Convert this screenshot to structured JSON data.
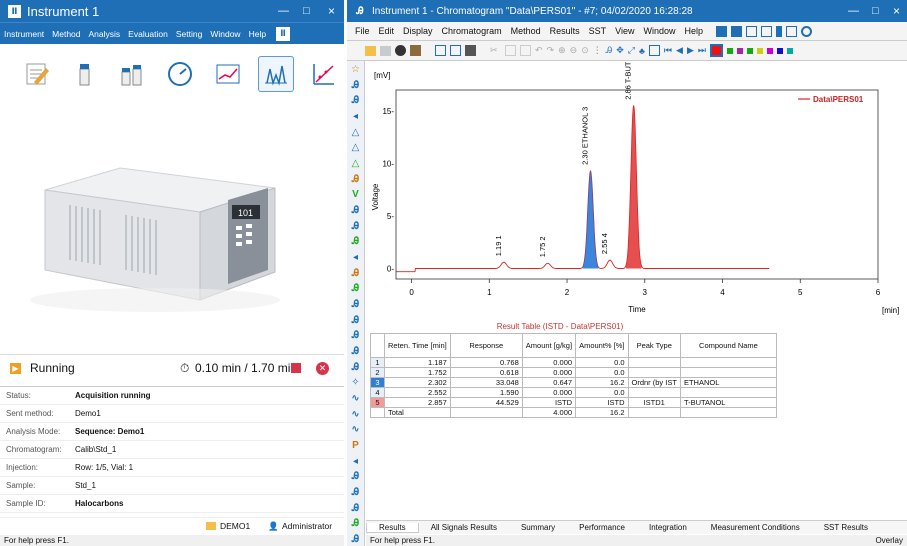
{
  "left_window": {
    "title": "Instrument 1",
    "controls": [
      "—",
      "□",
      "×"
    ],
    "menu": [
      "Instrument",
      "Method",
      "Analysis",
      "Evaluation",
      "Setting",
      "Window",
      "Help"
    ],
    "tools": [
      "edit-method-icon",
      "single-vial-icon",
      "sequence-vials-icon",
      "gauge-monitor-icon",
      "trend-chart-icon",
      "chromatogram-icon",
      "calibration-icon"
    ],
    "instrument_display": "101",
    "status_label": "Running",
    "time_text": "0.10 min / 1.70 min",
    "info": [
      {
        "k": "Status:",
        "v": "Acquisition running",
        "bold": true
      },
      {
        "k": "Sent method:",
        "v": "Demo1"
      },
      {
        "k": "Analysis Mode:",
        "v": "Sequence: Demo1",
        "bold": true
      },
      {
        "k": "Chromatogram:",
        "v": "Calib\\Std_1"
      },
      {
        "k": "Injection:",
        "v": "Row: 1/5, Vial: 1"
      },
      {
        "k": "Sample:",
        "v": "Std_1"
      },
      {
        "k": "Sample ID:",
        "v": "Halocarbons",
        "bold": true
      }
    ],
    "project": "DEMO1",
    "user": "Administrator",
    "statusbar": "For help press F1."
  },
  "right_window": {
    "title": "Instrument 1 - Chromatogram \"Data\\PERS01\" - #7;  04/02/2020  16:28:28",
    "menu": [
      "File",
      "Edit",
      "Display",
      "Chromatogram",
      "Method",
      "Results",
      "SST",
      "View",
      "Window",
      "Help"
    ],
    "statusbar": "For help press F1.",
    "overlay": "Overlay",
    "tabs": [
      "Results",
      "All Signals Results",
      "Summary",
      "Performance",
      "Integration",
      "Measurement Conditions",
      "SST Results"
    ]
  },
  "chart_data": {
    "type": "line",
    "ylabel": "Voltage",
    "yunit": "[mV]",
    "xlabel": "Time",
    "xunit": "[min]",
    "xlim": [
      -0.2,
      6
    ],
    "ylim": [
      -1,
      17
    ],
    "xticks": [
      "0",
      "1",
      "2",
      "3",
      "4",
      "5",
      "6"
    ],
    "yticks": [
      "0-",
      "5-",
      "10-",
      "15-"
    ],
    "legend": "Data\\PERS01",
    "peaks": [
      {
        "rt": 1.187,
        "h": 0.6,
        "label": "1.19  1",
        "color": "#d33"
      },
      {
        "rt": 1.752,
        "h": 0.5,
        "label": "1.75  2",
        "color": "#d33"
      },
      {
        "rt": 2.302,
        "h": 9.3,
        "label": "2.30 ETHANOL  3",
        "color": "#1b6fd6"
      },
      {
        "rt": 2.552,
        "h": 0.8,
        "label": "2.55  4",
        "color": "#d33"
      },
      {
        "rt": 2.857,
        "h": 15.5,
        "label": "2.86 T-BUTANOL  5",
        "color": "#e03030"
      }
    ]
  },
  "result_table": {
    "title": "Result Table (ISTD - Data\\PERS01)",
    "headers": [
      "",
      "Reten. Time [min]",
      "Response",
      "Amount [g/kg]",
      "Amount% [%]",
      "Peak Type",
      "Compound Name"
    ],
    "rows": [
      [
        "1",
        "1.187",
        "0.768",
        "0.000",
        "0.0",
        "",
        ""
      ],
      [
        "2",
        "1.752",
        "0.618",
        "0.000",
        "0.0",
        "",
        ""
      ],
      [
        "3",
        "2.302",
        "33.048",
        "0.647",
        "16.2",
        "Ordnr (by IST",
        "ETHANOL"
      ],
      [
        "4",
        "2.552",
        "1.590",
        "0.000",
        "0.0",
        "",
        ""
      ],
      [
        "5",
        "2.857",
        "44.529",
        "ISTD",
        "ISTD",
        "ISTD1",
        "T-BUTANOL"
      ]
    ],
    "total": [
      "Total",
      "",
      "",
      "4.000",
      "16.2",
      "",
      ""
    ]
  }
}
